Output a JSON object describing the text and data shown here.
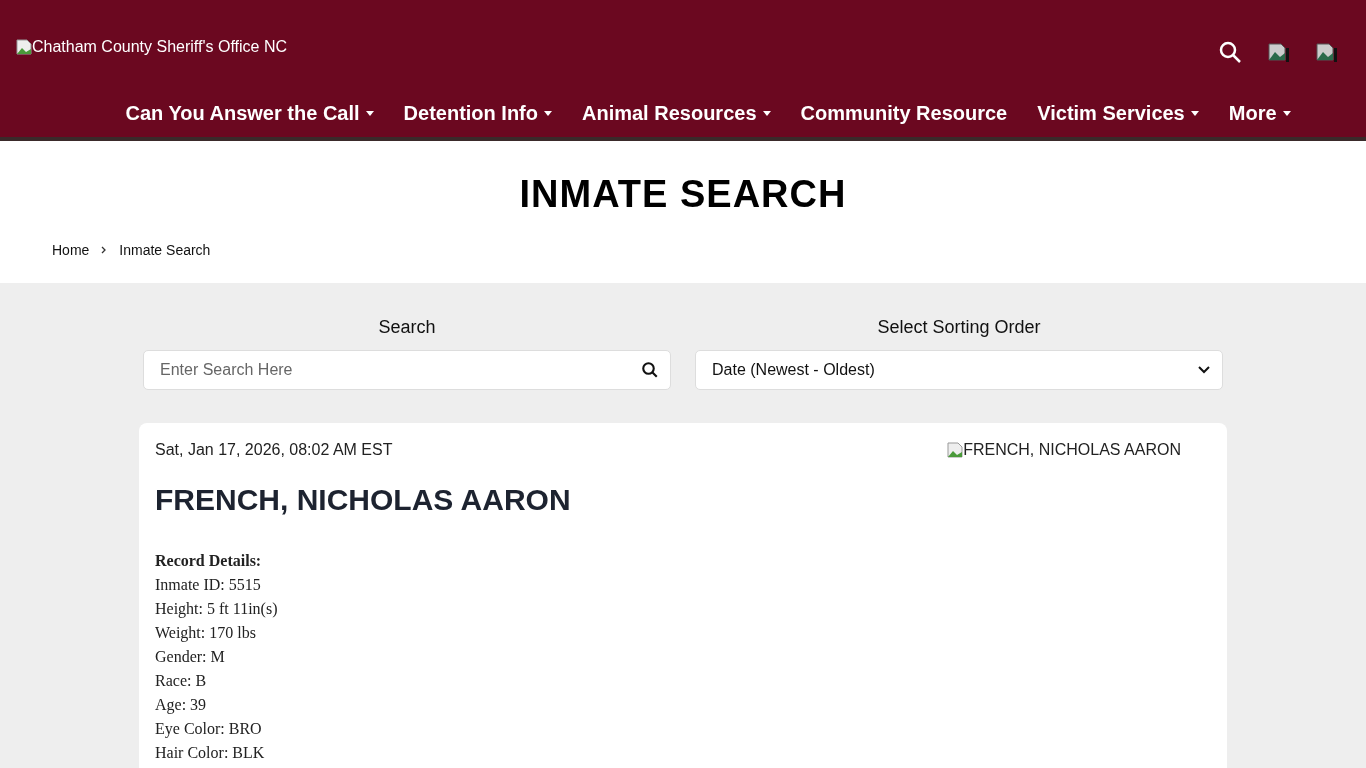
{
  "header": {
    "logo_alt": "Chatham County Sheriff's Office NC"
  },
  "nav": [
    {
      "label": "Can You Answer the Call",
      "has_menu": true
    },
    {
      "label": "Detention Info",
      "has_menu": true
    },
    {
      "label": "Animal Resources",
      "has_menu": true
    },
    {
      "label": "Community Resource",
      "has_menu": false
    },
    {
      "label": "Victim Services",
      "has_menu": true
    },
    {
      "label": "More",
      "has_menu": true
    }
  ],
  "page_title": "INMATE SEARCH",
  "breadcrumb": [
    "Home",
    "Inmate Search"
  ],
  "search": {
    "label": "Search",
    "placeholder": "Enter Search Here"
  },
  "sort": {
    "label": "Select Sorting Order",
    "value": "Date (Newest - Oldest)"
  },
  "record": {
    "date": "Sat, Jan 17, 2026, 08:02 AM EST",
    "photo_alt": "FRENCH, NICHOLAS AARON",
    "name": "FRENCH, NICHOLAS AARON",
    "details_title": "Record Details:",
    "details": [
      "Inmate ID: 5515",
      "Height: 5 ft 11in(s)",
      "Weight: 170 lbs",
      "Gender: M",
      "Race: B",
      "Age: 39",
      "Eye Color: BRO",
      "Hair Color: BLK"
    ]
  }
}
